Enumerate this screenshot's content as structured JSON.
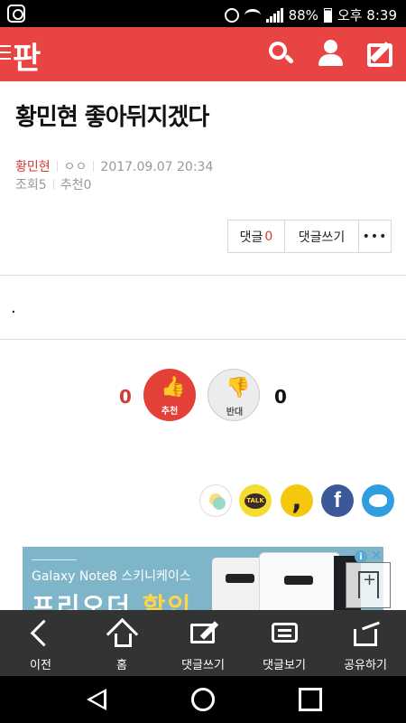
{
  "status": {
    "battery": "88%",
    "time": "오후 8:39"
  },
  "app": {
    "logo": "판"
  },
  "post": {
    "title": "황민현 좋아뒤지겠다",
    "author": "황민현",
    "author_sub": "ㅇㅇ",
    "datetime": "2017.09.07 20:34",
    "views_label": "조회",
    "views": "5",
    "recommend_label": "추천",
    "recommend": "0",
    "body": "."
  },
  "actions": {
    "comment_label": "댓글",
    "comment_count": "0",
    "write_comment": "댓글쓰기",
    "more": "•••"
  },
  "votes": {
    "up_label": "추천",
    "up_count": "0",
    "down_label": "반대",
    "down_count": "0"
  },
  "share": {
    "kakao_talk": "TALK"
  },
  "ad": {
    "title": "Galaxy Note8 스키니케이스",
    "headline_part1": "프리오더",
    "headline_highlight": "할인",
    "info": "i",
    "close": "✕"
  },
  "bottom_toolbar": [
    {
      "label": "이전",
      "icon": "back-icon"
    },
    {
      "label": "홈",
      "icon": "home-icon"
    },
    {
      "label": "댓글쓰기",
      "icon": "write-comment-icon"
    },
    {
      "label": "댓글보기",
      "icon": "view-comments-icon"
    },
    {
      "label": "공유하기",
      "icon": "share-icon"
    }
  ],
  "colors": {
    "brand_red": "#e84444",
    "accent_red": "#d23b34",
    "toolbar_bg": "#333333",
    "facebook": "#3b5898",
    "twitter": "#2f9de0",
    "kakao": "#f5dc32"
  }
}
